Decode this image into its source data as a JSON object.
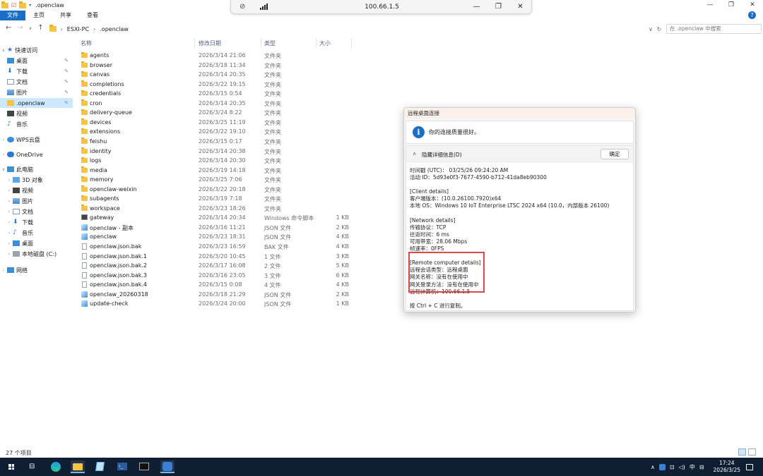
{
  "window": {
    "title": ".openclaw",
    "controls": {
      "minimize": "—",
      "maximize": "❐",
      "close": "✕"
    }
  },
  "ribbon": {
    "tabs": [
      "文件",
      "主页",
      "共享",
      "查看"
    ],
    "help": "?"
  },
  "address": {
    "breadcrumb": [
      "ESXI-PC",
      ".openclaw"
    ],
    "search_placeholder": "在 .openclaw 中搜索"
  },
  "columns": {
    "name": "名称",
    "date": "修改日期",
    "type": "类型",
    "size": "大小"
  },
  "navpane": {
    "quick_access": "快速访问",
    "quick_items": [
      "桌面",
      "下载",
      "文档",
      "图片",
      ".openclaw",
      "视频",
      "音乐"
    ],
    "wps": "WPS云盘",
    "onedrive": "OneDrive",
    "thispc": "此电脑",
    "pc_items": [
      "3D 对象",
      "视频",
      "图片",
      "文档",
      "下载",
      "音乐",
      "桌面",
      "本地磁盘 (C:)"
    ],
    "network": "网络"
  },
  "files": [
    {
      "name": "agents",
      "date": "2026/3/14 21:06",
      "type": "文件夹",
      "size": "",
      "icon": "folder"
    },
    {
      "name": "browser",
      "date": "2026/3/18 11:34",
      "type": "文件夹",
      "size": "",
      "icon": "folder"
    },
    {
      "name": "canvas",
      "date": "2026/3/14 20:35",
      "type": "文件夹",
      "size": "",
      "icon": "folder"
    },
    {
      "name": "completions",
      "date": "2026/3/22 19:15",
      "type": "文件夹",
      "size": "",
      "icon": "folder"
    },
    {
      "name": "credentials",
      "date": "2026/3/15 0:54",
      "type": "文件夹",
      "size": "",
      "icon": "folder"
    },
    {
      "name": "cron",
      "date": "2026/3/14 20:35",
      "type": "文件夹",
      "size": "",
      "icon": "folder"
    },
    {
      "name": "delivery-queue",
      "date": "2026/3/24 8:22",
      "type": "文件夹",
      "size": "",
      "icon": "folder"
    },
    {
      "name": "devices",
      "date": "2026/3/25 11:19",
      "type": "文件夹",
      "size": "",
      "icon": "folder"
    },
    {
      "name": "extensions",
      "date": "2026/3/22 19:10",
      "type": "文件夹",
      "size": "",
      "icon": "folder"
    },
    {
      "name": "feishu",
      "date": "2026/3/15 0:17",
      "type": "文件夹",
      "size": "",
      "icon": "folder"
    },
    {
      "name": "identity",
      "date": "2026/3/14 20:38",
      "type": "文件夹",
      "size": "",
      "icon": "folder"
    },
    {
      "name": "logs",
      "date": "2026/3/14 20:30",
      "type": "文件夹",
      "size": "",
      "icon": "folder"
    },
    {
      "name": "media",
      "date": "2026/3/19 14:18",
      "type": "文件夹",
      "size": "",
      "icon": "folder"
    },
    {
      "name": "memory",
      "date": "2026/3/25 7:06",
      "type": "文件夹",
      "size": "",
      "icon": "folder"
    },
    {
      "name": "openclaw-weixin",
      "date": "2026/3/22 20:18",
      "type": "文件夹",
      "size": "",
      "icon": "folder"
    },
    {
      "name": "subagents",
      "date": "2026/3/19 7:18",
      "type": "文件夹",
      "size": "",
      "icon": "folder"
    },
    {
      "name": "workspace",
      "date": "2026/3/23 18:26",
      "type": "文件夹",
      "size": "",
      "icon": "folder"
    },
    {
      "name": "gateway",
      "date": "2026/3/14 20:34",
      "type": "Windows 命令脚本",
      "size": "1 KB",
      "icon": "cmd"
    },
    {
      "name": "openclaw - 副本",
      "date": "2026/3/16 11:21",
      "type": "JSON 文件",
      "size": "2 KB",
      "icon": "json"
    },
    {
      "name": "openclaw",
      "date": "2026/3/23 18:31",
      "type": "JSON 文件",
      "size": "4 KB",
      "icon": "json"
    },
    {
      "name": "openclaw.json.bak",
      "date": "2026/3/23 16:59",
      "type": "BAK 文件",
      "size": "4 KB",
      "icon": "file"
    },
    {
      "name": "openclaw.json.bak.1",
      "date": "2026/3/20 10:45",
      "type": "1 文件",
      "size": "3 KB",
      "icon": "file"
    },
    {
      "name": "openclaw.json.bak.2",
      "date": "2026/3/17 16:08",
      "type": "2 文件",
      "size": "5 KB",
      "icon": "file"
    },
    {
      "name": "openclaw.json.bak.3",
      "date": "2026/3/16 23:05",
      "type": "3 文件",
      "size": "6 KB",
      "icon": "file"
    },
    {
      "name": "openclaw.json.bak.4",
      "date": "2026/3/15 0:08",
      "type": "4 文件",
      "size": "4 KB",
      "icon": "file"
    },
    {
      "name": "openclaw_20260318",
      "date": "2026/3/18 21:29",
      "type": "JSON 文件",
      "size": "2 KB",
      "icon": "json"
    },
    {
      "name": "update-check",
      "date": "2026/3/24 20:00",
      "type": "JSON 文件",
      "size": "1 KB",
      "icon": "json"
    }
  ],
  "status": {
    "count": "27 个项目"
  },
  "rdp_bar": {
    "ip": "100.66.1.5"
  },
  "dialog": {
    "title": "远程桌面连接",
    "quality_msg": "你的连接质量很好。",
    "hide_details": "隐藏详细信息(D)",
    "ok": "确定",
    "lines": [
      "时间戳 (UTC)： 03/25/26 09:24:20 AM",
      "活动 ID：5d93e0f3-7677-4590-b712-41da8eb90300",
      "",
      "[Client details]",
      "客户端版本：(10.0.26100.7920)x64",
      "本地 OS：Windows 10 IoT Enterprise LTSC 2024 x64 (10.0，内部版本 26100)",
      "",
      "[Network details]",
      "传输协议：TCP",
      "往返时间：6 ms",
      "可用带宽：28.06 Mbps",
      "帧速率：0FPS",
      "",
      "[Remote computer details]",
      "远程会话类型：远程桌面",
      "网关名称：没有在使用中",
      "网关登录方法：没有在使用中",
      "远程计算机：100.66.1.5",
      "",
      "按 Ctrl + C 进行复制。"
    ]
  },
  "taskbar": {
    "time": "17:24",
    "date": "2026/3/25",
    "ime": "中"
  },
  "colors": {
    "accent": "#1a6fc4",
    "highlight": "#e04848",
    "taskbar": "#0f1e33",
    "selected": "#cce8ff"
  }
}
